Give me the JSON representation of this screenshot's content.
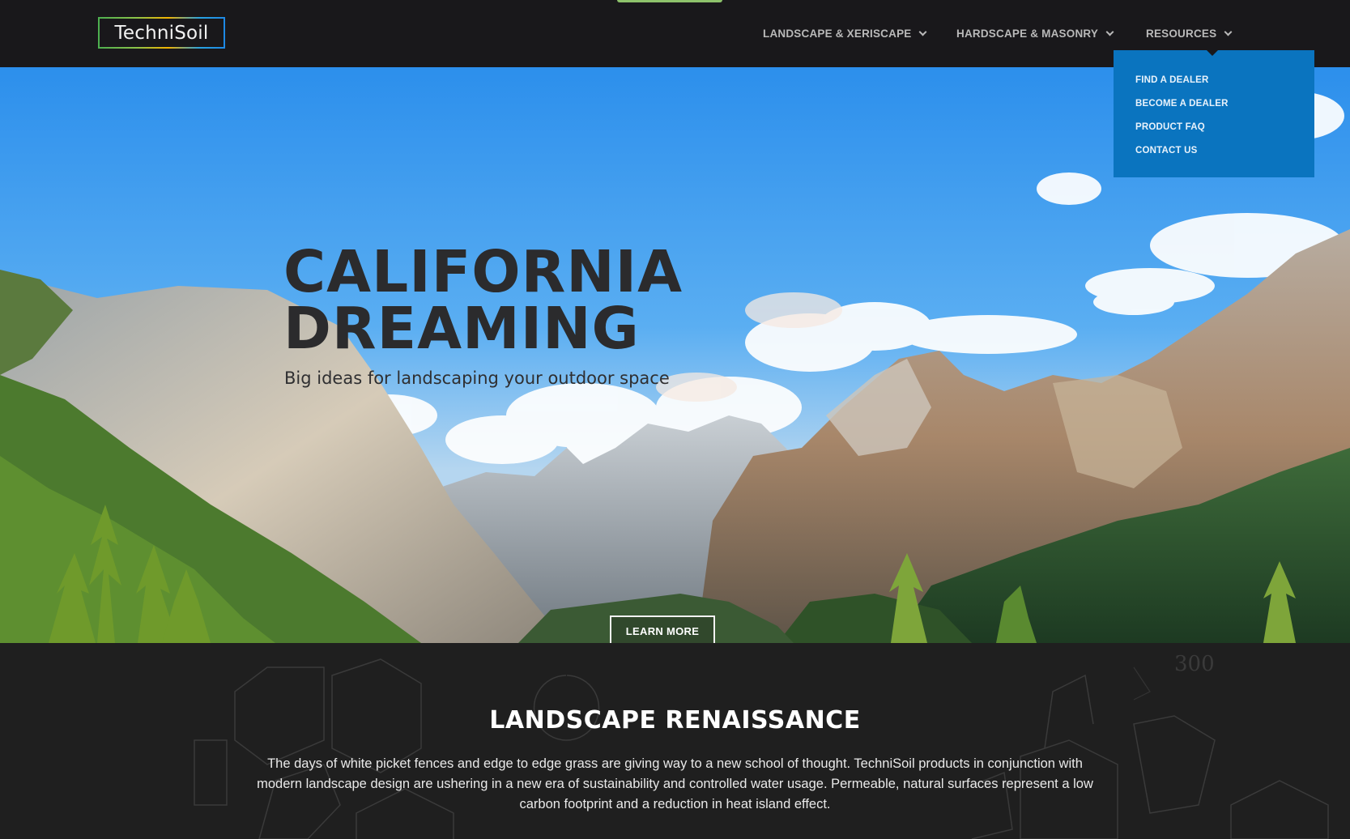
{
  "header": {
    "logo_text": "TechniSoil",
    "nav": [
      {
        "label": "LANDSCAPE & XERISCAPE",
        "icon": "chevron-down-icon"
      },
      {
        "label": "HARDSCAPE & MASONRY",
        "icon": "chevron-down-icon"
      },
      {
        "label": "RESOURCES",
        "icon": "chevron-down-icon"
      }
    ]
  },
  "dropdown": {
    "items": [
      "FIND A DEALER",
      "BECOME A DEALER",
      "PRODUCT FAQ",
      "CONTACT US"
    ],
    "background": "#0a74bf"
  },
  "hero": {
    "title": "CALIFORNIA\nDREAMING",
    "subtitle": "Big ideas for landscaping your outdoor space",
    "button_label": "LEARN MORE"
  },
  "section": {
    "title": "LANDSCAPE RENAISSANCE",
    "body": "The days of white picket fences and edge to edge grass are giving way to a new school of thought. TechniSoil products in conjunction with modern landscape design are ushering in a new era of sustainability and controlled water usage. Permeable, natural surfaces represent a low carbon footprint and a reduction in heat island effect.",
    "decoration_number": "300"
  },
  "colors": {
    "header_bg": "#19181b",
    "accent_green": "#8dc26b",
    "dropdown_blue": "#0a74bf",
    "section_bg": "#1f1f1f"
  }
}
